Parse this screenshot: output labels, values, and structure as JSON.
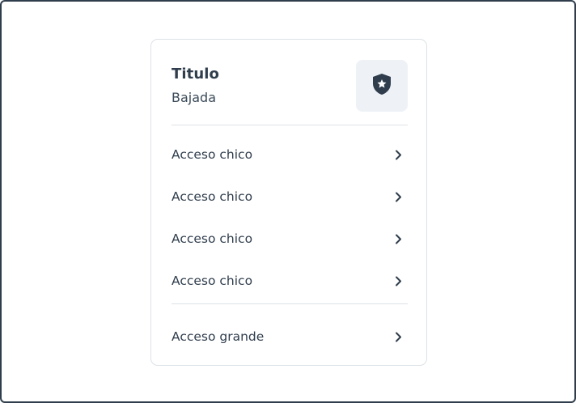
{
  "card": {
    "title": "Titulo",
    "subtitle": "Bajada",
    "icon": "shield-star-icon",
    "small_links": [
      {
        "label": "Acceso chico",
        "icon": "chevron-right-icon"
      },
      {
        "label": "Acceso chico",
        "icon": "chevron-right-icon"
      },
      {
        "label": "Acceso chico",
        "icon": "chevron-right-icon"
      },
      {
        "label": "Acceso chico",
        "icon": "chevron-right-icon"
      }
    ],
    "large_link": {
      "label": "Acceso grande",
      "icon": "chevron-right-icon"
    }
  },
  "colors": {
    "frame_border": "#2f3d4c",
    "text": "#2f3d4c",
    "icon_bg": "#eef2f6",
    "divider": "#dde2e7"
  }
}
